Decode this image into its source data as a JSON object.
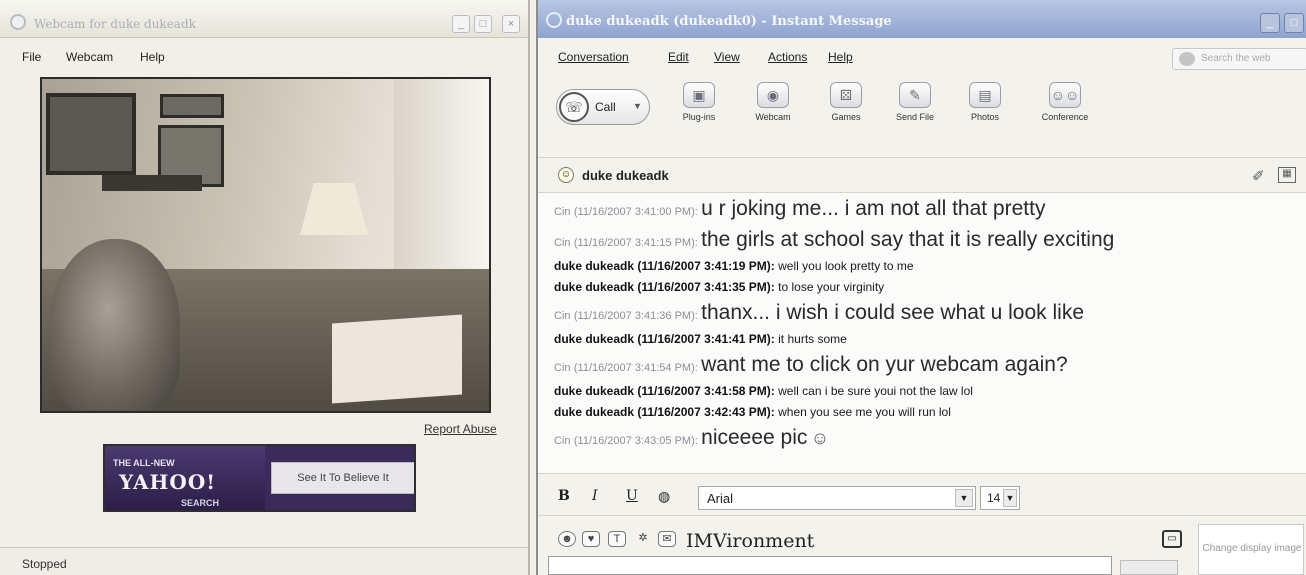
{
  "webcam_window": {
    "title": "Webcam for duke dukeadk",
    "menu": [
      "File",
      "Webcam",
      "Help"
    ],
    "report_abuse": "Report Abuse",
    "ad": {
      "small_text": "THE ALL-NEW",
      "logo": "YAHOO!",
      "sub": "SEARCH",
      "cta": "See It To Believe It"
    },
    "status": "Stopped"
  },
  "im_window": {
    "title": "duke dukeadk (dukeadk0) - Instant Message",
    "menu": [
      "Conversation",
      "Edit",
      "View",
      "Actions",
      "Help"
    ],
    "search_placeholder": "Search the web",
    "toolbar": {
      "call_label": "Call",
      "tools": [
        "Plug-ins",
        "Webcam",
        "Games",
        "Send File",
        "Photos",
        "Conference"
      ]
    },
    "contact_name": "duke dukeadk",
    "messages": [
      {
        "sender": "Cin",
        "time": "(11/16/2007 3:41:00 PM):",
        "text": "u r joking me... i am not all that pretty",
        "style": "cin"
      },
      {
        "sender": "Cin",
        "time": "(11/16/2007 3:41:15 PM):",
        "text": "the girls at school say that it is really exciting",
        "style": "cin"
      },
      {
        "sender": "duke dukeadk",
        "time": "(11/16/2007 3:41:19 PM):",
        "text": "well you look pretty to me",
        "style": "duke"
      },
      {
        "sender": "duke dukeadk",
        "time": "(11/16/2007 3:41:35 PM):",
        "text": "to lose your virginity",
        "style": "duke"
      },
      {
        "sender": "Cin",
        "time": "(11/16/2007 3:41:36 PM):",
        "text": "thanx... i wish i could see what u look like",
        "style": "cin"
      },
      {
        "sender": "duke dukeadk",
        "time": "(11/16/2007 3:41:41 PM):",
        "text": "it hurts some",
        "style": "duke"
      },
      {
        "sender": "Cin",
        "time": "(11/16/2007 3:41:54 PM):",
        "text": "want me to click on yur webcam again?",
        "style": "cin"
      },
      {
        "sender": "duke dukeadk",
        "time": "(11/16/2007 3:41:58 PM):",
        "text": "well can i be sure youi not the law lol",
        "style": "duke"
      },
      {
        "sender": "duke dukeadk",
        "time": "(11/16/2007 3:42:43 PM):",
        "text": "when you see me you will run lol",
        "style": "duke"
      },
      {
        "sender": "Cin",
        "time": "(11/16/2007 3:43:05 PM):",
        "text": "niceeee pic",
        "style": "cin",
        "emoticon": "☺"
      }
    ],
    "format": {
      "bold": "B",
      "italic": "I",
      "underline": "U",
      "font": "Arial",
      "size": "14"
    },
    "imvironment_label": "IMVironment",
    "display_image_label": "Change display image"
  }
}
